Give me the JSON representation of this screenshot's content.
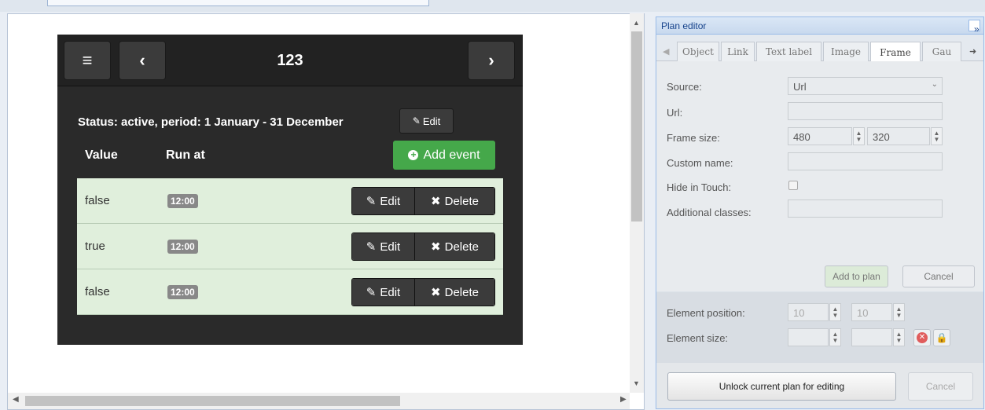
{
  "widget": {
    "menu_icon": "≡",
    "prev_icon": "‹",
    "next_icon": "›",
    "title": "123",
    "status_text": "Status: active, period: 1 January - 31 December",
    "status_edit_label": "Edit",
    "columns": {
      "value": "Value",
      "run_at": "Run at"
    },
    "add_event_label": "Add event",
    "rows": [
      {
        "value": "false",
        "time": "12:00",
        "edit": "Edit",
        "delete": "Delete"
      },
      {
        "value": "true",
        "time": "12:00",
        "edit": "Edit",
        "delete": "Delete"
      },
      {
        "value": "false",
        "time": "12:00",
        "edit": "Edit",
        "delete": "Delete"
      }
    ]
  },
  "panel": {
    "title": "Plan editor",
    "collapse_icon": "»",
    "tabs": [
      "Object",
      "Link",
      "Text label",
      "Image",
      "Frame",
      "Gau"
    ],
    "active_tab": "Frame",
    "form": {
      "source_label": "Source:",
      "source_value": "Url",
      "url_label": "Url:",
      "url_value": "",
      "frame_size_label": "Frame size:",
      "frame_width": "480",
      "frame_height": "320",
      "custom_name_label": "Custom name:",
      "hide_touch_label": "Hide in Touch:",
      "additional_classes_label": "Additional classes:",
      "add_to_plan_label": "Add to plan",
      "cancel_label": "Cancel"
    },
    "position": {
      "element_position_label": "Element position:",
      "pos_x": "10",
      "pos_y": "10",
      "element_size_label": "Element size:"
    },
    "bottom": {
      "unlock_label": "Unlock current plan for editing",
      "cancel_label": "Cancel"
    }
  },
  "colors": {
    "add_button": "#45a84a",
    "row_background": "#e0efdc",
    "panel_title": "#15428b"
  }
}
